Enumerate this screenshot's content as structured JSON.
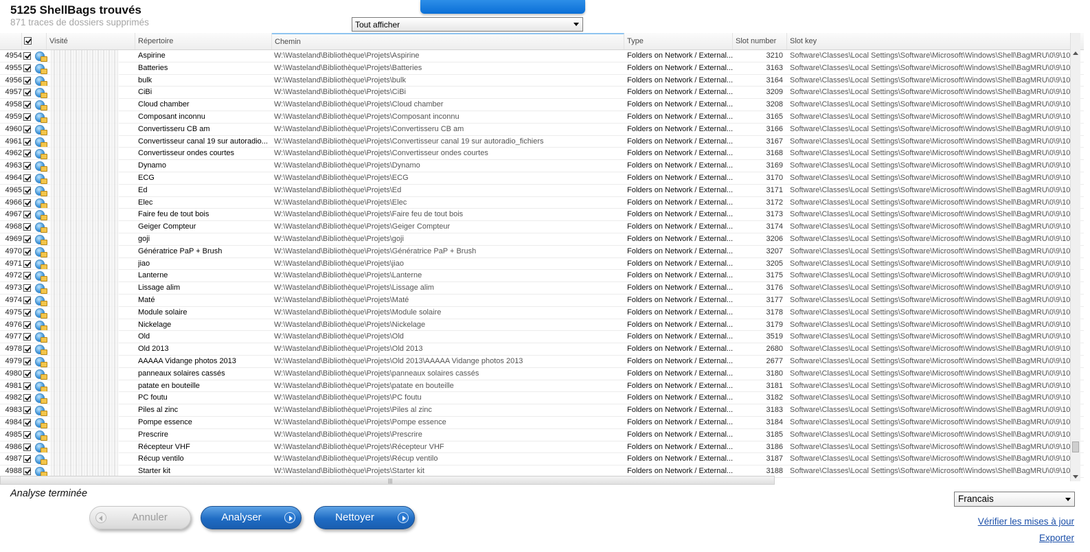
{
  "header": {
    "title": "5125 ShellBags trouvés",
    "subtitle": "871 traces de dossiers supprimés",
    "filter_value": "Tout afficher"
  },
  "columns": {
    "visited": "Visité",
    "directory": "Répertoire",
    "path": "Chemin",
    "type": "Type",
    "slot_number": "Slot number",
    "slot_key": "Slot key"
  },
  "rows": [
    {
      "num": "4954",
      "dir": "Aspirine",
      "path": "W:\\Wasteland\\Bibliothèque\\Projets\\Aspirine",
      "type": "Folders on Network / External...",
      "slot": "3210",
      "key": "Software\\Classes\\Local Settings\\Software\\Microsoft\\Windows\\Shell\\BagMRU\\0\\9\\10\\"
    },
    {
      "num": "4955",
      "dir": "Batteries",
      "path": "W:\\Wasteland\\Bibliothèque\\Projets\\Batteries",
      "type": "Folders on Network / External...",
      "slot": "3163",
      "key": "Software\\Classes\\Local Settings\\Software\\Microsoft\\Windows\\Shell\\BagMRU\\0\\9\\10\\"
    },
    {
      "num": "4956",
      "dir": "bulk",
      "path": "W:\\Wasteland\\Bibliothèque\\Projets\\bulk",
      "type": "Folders on Network / External...",
      "slot": "3164",
      "key": "Software\\Classes\\Local Settings\\Software\\Microsoft\\Windows\\Shell\\BagMRU\\0\\9\\10\\"
    },
    {
      "num": "4957",
      "dir": "CiBi",
      "path": "W:\\Wasteland\\Bibliothèque\\Projets\\CiBi",
      "type": "Folders on Network / External...",
      "slot": "3209",
      "key": "Software\\Classes\\Local Settings\\Software\\Microsoft\\Windows\\Shell\\BagMRU\\0\\9\\10\\"
    },
    {
      "num": "4958",
      "dir": "Cloud chamber",
      "path": "W:\\Wasteland\\Bibliothèque\\Projets\\Cloud chamber",
      "type": "Folders on Network / External...",
      "slot": "3208",
      "key": "Software\\Classes\\Local Settings\\Software\\Microsoft\\Windows\\Shell\\BagMRU\\0\\9\\10\\"
    },
    {
      "num": "4959",
      "dir": "Composant inconnu",
      "path": "W:\\Wasteland\\Bibliothèque\\Projets\\Composant inconnu",
      "type": "Folders on Network / External...",
      "slot": "3165",
      "key": "Software\\Classes\\Local Settings\\Software\\Microsoft\\Windows\\Shell\\BagMRU\\0\\9\\10\\"
    },
    {
      "num": "4960",
      "dir": "Convertisseru CB am",
      "path": "W:\\Wasteland\\Bibliothèque\\Projets\\Convertisseru CB am",
      "type": "Folders on Network / External...",
      "slot": "3166",
      "key": "Software\\Classes\\Local Settings\\Software\\Microsoft\\Windows\\Shell\\BagMRU\\0\\9\\10\\"
    },
    {
      "num": "4961",
      "dir": "Convertisseur canal 19 sur autoradio...",
      "path": "W:\\Wasteland\\Bibliothèque\\Projets\\Convertisseur canal 19 sur autoradio_fichiers",
      "type": "Folders on Network / External...",
      "slot": "3167",
      "key": "Software\\Classes\\Local Settings\\Software\\Microsoft\\Windows\\Shell\\BagMRU\\0\\9\\10\\"
    },
    {
      "num": "4962",
      "dir": "Convertisseur ondes courtes",
      "path": "W:\\Wasteland\\Bibliothèque\\Projets\\Convertisseur ondes courtes",
      "type": "Folders on Network / External...",
      "slot": "3168",
      "key": "Software\\Classes\\Local Settings\\Software\\Microsoft\\Windows\\Shell\\BagMRU\\0\\9\\10\\"
    },
    {
      "num": "4963",
      "dir": "Dynamo",
      "path": "W:\\Wasteland\\Bibliothèque\\Projets\\Dynamo",
      "type": "Folders on Network / External...",
      "slot": "3169",
      "key": "Software\\Classes\\Local Settings\\Software\\Microsoft\\Windows\\Shell\\BagMRU\\0\\9\\10\\"
    },
    {
      "num": "4964",
      "dir": "ECG",
      "path": "W:\\Wasteland\\Bibliothèque\\Projets\\ECG",
      "type": "Folders on Network / External...",
      "slot": "3170",
      "key": "Software\\Classes\\Local Settings\\Software\\Microsoft\\Windows\\Shell\\BagMRU\\0\\9\\10\\"
    },
    {
      "num": "4965",
      "dir": "Ed",
      "path": "W:\\Wasteland\\Bibliothèque\\Projets\\Ed",
      "type": "Folders on Network / External...",
      "slot": "3171",
      "key": "Software\\Classes\\Local Settings\\Software\\Microsoft\\Windows\\Shell\\BagMRU\\0\\9\\10\\"
    },
    {
      "num": "4966",
      "dir": "Elec",
      "path": "W:\\Wasteland\\Bibliothèque\\Projets\\Elec",
      "type": "Folders on Network / External...",
      "slot": "3172",
      "key": "Software\\Classes\\Local Settings\\Software\\Microsoft\\Windows\\Shell\\BagMRU\\0\\9\\10\\"
    },
    {
      "num": "4967",
      "dir": "Faire feu de tout bois",
      "path": "W:\\Wasteland\\Bibliothèque\\Projets\\Faire feu de tout bois",
      "type": "Folders on Network / External...",
      "slot": "3173",
      "key": "Software\\Classes\\Local Settings\\Software\\Microsoft\\Windows\\Shell\\BagMRU\\0\\9\\10\\"
    },
    {
      "num": "4968",
      "dir": "Geiger Compteur",
      "path": "W:\\Wasteland\\Bibliothèque\\Projets\\Geiger Compteur",
      "type": "Folders on Network / External...",
      "slot": "3174",
      "key": "Software\\Classes\\Local Settings\\Software\\Microsoft\\Windows\\Shell\\BagMRU\\0\\9\\10\\"
    },
    {
      "num": "4969",
      "dir": "goji",
      "path": "W:\\Wasteland\\Bibliothèque\\Projets\\goji",
      "type": "Folders on Network / External...",
      "slot": "3206",
      "key": "Software\\Classes\\Local Settings\\Software\\Microsoft\\Windows\\Shell\\BagMRU\\0\\9\\10\\"
    },
    {
      "num": "4970",
      "dir": "Génératrice PaP + Brush",
      "path": "W:\\Wasteland\\Bibliothèque\\Projets\\Génératrice PaP + Brush",
      "type": "Folders on Network / External...",
      "slot": "3207",
      "key": "Software\\Classes\\Local Settings\\Software\\Microsoft\\Windows\\Shell\\BagMRU\\0\\9\\10\\"
    },
    {
      "num": "4971",
      "dir": "jiao",
      "path": "W:\\Wasteland\\Bibliothèque\\Projets\\jiao",
      "type": "Folders on Network / External...",
      "slot": "3205",
      "key": "Software\\Classes\\Local Settings\\Software\\Microsoft\\Windows\\Shell\\BagMRU\\0\\9\\10\\"
    },
    {
      "num": "4972",
      "dir": "Lanterne",
      "path": "W:\\Wasteland\\Bibliothèque\\Projets\\Lanterne",
      "type": "Folders on Network / External...",
      "slot": "3175",
      "key": "Software\\Classes\\Local Settings\\Software\\Microsoft\\Windows\\Shell\\BagMRU\\0\\9\\10\\"
    },
    {
      "num": "4973",
      "dir": "Lissage alim",
      "path": "W:\\Wasteland\\Bibliothèque\\Projets\\Lissage alim",
      "type": "Folders on Network / External...",
      "slot": "3176",
      "key": "Software\\Classes\\Local Settings\\Software\\Microsoft\\Windows\\Shell\\BagMRU\\0\\9\\10\\"
    },
    {
      "num": "4974",
      "dir": "Maté",
      "path": "W:\\Wasteland\\Bibliothèque\\Projets\\Maté",
      "type": "Folders on Network / External...",
      "slot": "3177",
      "key": "Software\\Classes\\Local Settings\\Software\\Microsoft\\Windows\\Shell\\BagMRU\\0\\9\\10\\"
    },
    {
      "num": "4975",
      "dir": "Module solaire",
      "path": "W:\\Wasteland\\Bibliothèque\\Projets\\Module solaire",
      "type": "Folders on Network / External...",
      "slot": "3178",
      "key": "Software\\Classes\\Local Settings\\Software\\Microsoft\\Windows\\Shell\\BagMRU\\0\\9\\10\\"
    },
    {
      "num": "4976",
      "dir": "Nickelage",
      "path": "W:\\Wasteland\\Bibliothèque\\Projets\\Nickelage",
      "type": "Folders on Network / External...",
      "slot": "3179",
      "key": "Software\\Classes\\Local Settings\\Software\\Microsoft\\Windows\\Shell\\BagMRU\\0\\9\\10\\"
    },
    {
      "num": "4977",
      "dir": "Old",
      "path": "W:\\Wasteland\\Bibliothèque\\Projets\\Old",
      "type": "Folders on Network / External...",
      "slot": "3519",
      "key": "Software\\Classes\\Local Settings\\Software\\Microsoft\\Windows\\Shell\\BagMRU\\0\\9\\10\\"
    },
    {
      "num": "4978",
      "dir": "Old 2013",
      "path": "W:\\Wasteland\\Bibliothèque\\Projets\\Old 2013",
      "type": "Folders on Network / External...",
      "slot": "2680",
      "key": "Software\\Classes\\Local Settings\\Software\\Microsoft\\Windows\\Shell\\BagMRU\\0\\9\\10\\"
    },
    {
      "num": "4979",
      "dir": "AAAAA Vidange photos 2013",
      "path": "W:\\Wasteland\\Bibliothèque\\Projets\\Old 2013\\AAAAA Vidange photos 2013",
      "type": "Folders on Network / External...",
      "slot": "2677",
      "key": "Software\\Classes\\Local Settings\\Software\\Microsoft\\Windows\\Shell\\BagMRU\\0\\9\\10\\"
    },
    {
      "num": "4980",
      "dir": "panneaux solaires cassés",
      "path": "W:\\Wasteland\\Bibliothèque\\Projets\\panneaux solaires cassés",
      "type": "Folders on Network / External...",
      "slot": "3180",
      "key": "Software\\Classes\\Local Settings\\Software\\Microsoft\\Windows\\Shell\\BagMRU\\0\\9\\10\\"
    },
    {
      "num": "4981",
      "dir": "patate en bouteille",
      "path": "W:\\Wasteland\\Bibliothèque\\Projets\\patate en bouteille",
      "type": "Folders on Network / External...",
      "slot": "3181",
      "key": "Software\\Classes\\Local Settings\\Software\\Microsoft\\Windows\\Shell\\BagMRU\\0\\9\\10\\"
    },
    {
      "num": "4982",
      "dir": "PC foutu",
      "path": "W:\\Wasteland\\Bibliothèque\\Projets\\PC foutu",
      "type": "Folders on Network / External...",
      "slot": "3182",
      "key": "Software\\Classes\\Local Settings\\Software\\Microsoft\\Windows\\Shell\\BagMRU\\0\\9\\10\\"
    },
    {
      "num": "4983",
      "dir": "Piles al zinc",
      "path": "W:\\Wasteland\\Bibliothèque\\Projets\\Piles al zinc",
      "type": "Folders on Network / External...",
      "slot": "3183",
      "key": "Software\\Classes\\Local Settings\\Software\\Microsoft\\Windows\\Shell\\BagMRU\\0\\9\\10\\"
    },
    {
      "num": "4984",
      "dir": "Pompe essence",
      "path": "W:\\Wasteland\\Bibliothèque\\Projets\\Pompe essence",
      "type": "Folders on Network / External...",
      "slot": "3184",
      "key": "Software\\Classes\\Local Settings\\Software\\Microsoft\\Windows\\Shell\\BagMRU\\0\\9\\10\\"
    },
    {
      "num": "4985",
      "dir": "Prescrire",
      "path": "W:\\Wasteland\\Bibliothèque\\Projets\\Prescrire",
      "type": "Folders on Network / External...",
      "slot": "3185",
      "key": "Software\\Classes\\Local Settings\\Software\\Microsoft\\Windows\\Shell\\BagMRU\\0\\9\\10\\"
    },
    {
      "num": "4986",
      "dir": "Récepteur VHF",
      "path": "W:\\Wasteland\\Bibliothèque\\Projets\\Récepteur VHF",
      "type": "Folders on Network / External...",
      "slot": "3186",
      "key": "Software\\Classes\\Local Settings\\Software\\Microsoft\\Windows\\Shell\\BagMRU\\0\\9\\10\\"
    },
    {
      "num": "4987",
      "dir": "Récup ventilo",
      "path": "W:\\Wasteland\\Bibliothèque\\Projets\\Récup ventilo",
      "type": "Folders on Network / External...",
      "slot": "3187",
      "key": "Software\\Classes\\Local Settings\\Software\\Microsoft\\Windows\\Shell\\BagMRU\\0\\9\\10\\"
    },
    {
      "num": "4988",
      "dir": "Starter kit",
      "path": "W:\\Wasteland\\Bibliothèque\\Projets\\Starter kit",
      "type": "Folders on Network / External...",
      "slot": "3188",
      "key": "Software\\Classes\\Local Settings\\Software\\Microsoft\\Windows\\Shell\\BagMRU\\0\\9\\10\\"
    }
  ],
  "footer": {
    "status": "Analyse terminée",
    "cancel_label": "Annuler",
    "analyze_label": "Analyser",
    "clean_label": "Nettoyer",
    "language": "Francais",
    "update_link": "Vérifier les mises à jour",
    "export_link": "Exporter"
  },
  "colors": {
    "accent": "#1f6cc4",
    "link": "#1a4ea8"
  }
}
